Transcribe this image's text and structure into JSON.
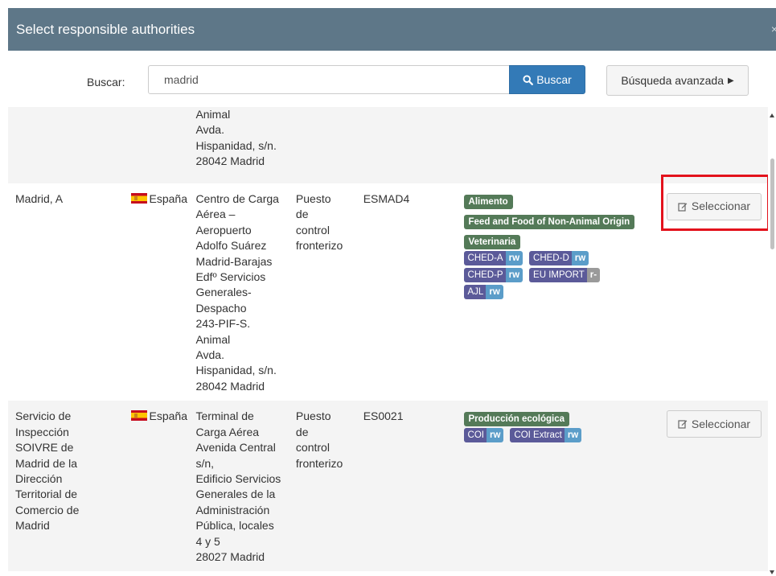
{
  "modal": {
    "title": "Select responsible authorities",
    "close_icon": "close-icon"
  },
  "search": {
    "label": "Buscar:",
    "value": "madrid",
    "button_label": "Buscar",
    "advanced_label": "Búsqueda avanzada"
  },
  "rows": [
    {
      "address_lines": [
        "Animal",
        "Avda.",
        "Hispanidad, s/n.",
        "28042 Madrid"
      ]
    },
    {
      "name": "Madrid, A",
      "country": "España",
      "address_lines": [
        "Centro de Carga",
        "Aérea –",
        "Aeropuerto",
        "Adolfo Suárez",
        "Madrid-Barajas",
        "Edfº Servicios",
        "Generales-",
        "Despacho",
        "243-PIF-S.",
        "Animal",
        "Avda.",
        "Hispanidad, s/n.",
        "28042 Madrid"
      ],
      "type_lines": [
        "Puesto",
        "de",
        "control",
        "fronterizo"
      ],
      "code": "ESMAD4",
      "labels": [
        "Alimento",
        "Feed and Food of Non-Animal Origin",
        "Veterinaria"
      ],
      "permissions": [
        {
          "name": "CHED-A",
          "right": "rw"
        },
        {
          "name": "CHED-D",
          "right": "rw"
        },
        {
          "name": "CHED-P",
          "right": "rw"
        },
        {
          "name": "EU IMPORT",
          "right": "r-"
        },
        {
          "name": "AJL",
          "right": "rw"
        }
      ],
      "select_label": "Seleccionar"
    },
    {
      "name_lines": [
        "Servicio de",
        "Inspección",
        "SOIVRE de",
        "Madrid de la",
        "Dirección",
        "Territorial de",
        "Comercio de",
        "Madrid"
      ],
      "country": "España",
      "address_lines": [
        "Terminal de",
        "Carga Aérea",
        "Avenida Central",
        "s/n,",
        "Edificio Servicios",
        "Generales de la",
        "Administración",
        "Pública, locales",
        "4 y 5",
        "28027 Madrid"
      ],
      "type_lines": [
        "Puesto",
        "de",
        "control",
        "fronterizo"
      ],
      "code": "ES0021",
      "labels": [
        "Producción ecológica"
      ],
      "permissions": [
        {
          "name": "COI",
          "right": "rw"
        },
        {
          "name": "COI Extract",
          "right": "rw"
        }
      ],
      "select_label": "Seleccionar"
    }
  ],
  "colors": {
    "header_bg": "#5e7788",
    "primary": "#337ab7",
    "label_green": "#547a58",
    "perm_purple": "#5b5a99",
    "perm_blue": "#5b9dc9",
    "highlight": "#e3121c"
  }
}
